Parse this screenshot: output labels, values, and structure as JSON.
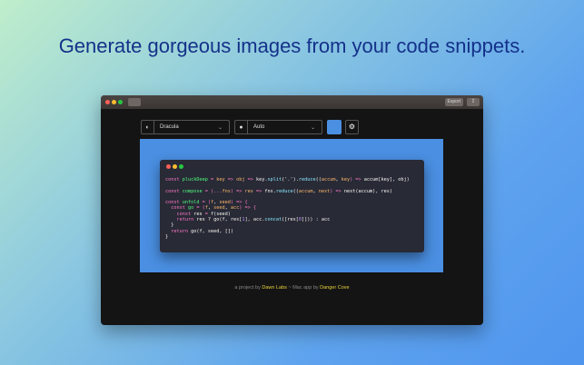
{
  "headline": "Generate gorgeous images from your code snippets.",
  "titlebar": {
    "export_label": "Export",
    "share_icon": "share-icon"
  },
  "toolbar": {
    "theme": "Dracula",
    "language": "Auto",
    "background_color": "#4a8fe2"
  },
  "code_window": {
    "background": "#282a36",
    "lines": [
      [
        [
          "const ",
          "k"
        ],
        [
          "pluckDeep",
          "f"
        ],
        [
          " = ",
          "k"
        ],
        [
          "key",
          "p"
        ],
        [
          " => ",
          "k"
        ],
        [
          "obj",
          "p"
        ],
        [
          " => ",
          "k"
        ],
        [
          "key.",
          "t"
        ],
        [
          "split",
          "c"
        ],
        [
          "('.').",
          "t"
        ],
        [
          "reduce",
          "c"
        ],
        [
          "((",
          "t"
        ],
        [
          "accum",
          "p"
        ],
        [
          ", ",
          "t"
        ],
        [
          "key",
          "p"
        ],
        [
          ") => ",
          "k"
        ],
        [
          "accum[key], obj)",
          "t"
        ]
      ],
      [],
      [
        [
          "const ",
          "k"
        ],
        [
          "compose",
          "f"
        ],
        [
          " = (...",
          "k"
        ],
        [
          "fns",
          "p"
        ],
        [
          ") => ",
          "k"
        ],
        [
          "res",
          "p"
        ],
        [
          " => ",
          "k"
        ],
        [
          "fns.",
          "t"
        ],
        [
          "reduce",
          "c"
        ],
        [
          "((",
          "t"
        ],
        [
          "accum",
          "p"
        ],
        [
          ", ",
          "t"
        ],
        [
          "next",
          "p"
        ],
        [
          ") => ",
          "k"
        ],
        [
          "next(accum), res)",
          "t"
        ]
      ],
      [],
      [
        [
          "const ",
          "k"
        ],
        [
          "unfold",
          "f"
        ],
        [
          " = (",
          "k"
        ],
        [
          "f",
          "p"
        ],
        [
          ", ",
          "t"
        ],
        [
          "seed",
          "p"
        ],
        [
          ") => {",
          "k"
        ]
      ],
      [
        [
          "  const ",
          "k"
        ],
        [
          "go",
          "f"
        ],
        [
          " = (",
          "k"
        ],
        [
          "f",
          "p"
        ],
        [
          ", ",
          "t"
        ],
        [
          "seed",
          "p"
        ],
        [
          ", ",
          "t"
        ],
        [
          "acc",
          "p"
        ],
        [
          ") => {",
          "k"
        ]
      ],
      [
        [
          "    const ",
          "k"
        ],
        [
          "res",
          "t"
        ],
        [
          " = ",
          "k"
        ],
        [
          "f(seed)",
          "t"
        ]
      ],
      [
        [
          "    return ",
          "k"
        ],
        [
          "res ? go(f, res[",
          "t"
        ],
        [
          "1",
          "n"
        ],
        [
          "], acc.",
          "t"
        ],
        [
          "concat",
          "c"
        ],
        [
          "([res[",
          "t"
        ],
        [
          "0",
          "n"
        ],
        [
          "]])) : acc",
          "t"
        ]
      ],
      [
        [
          "  }",
          "t"
        ]
      ],
      [
        [
          "  return ",
          "k"
        ],
        [
          "go(f, seed, [])",
          "t"
        ]
      ],
      [
        [
          "}",
          "t"
        ]
      ]
    ]
  },
  "footer": {
    "prefix": "a project by ",
    "author": "Dawn Labs",
    "middle": " ~ Mac app by ",
    "mac_author": "Danger Cove"
  }
}
